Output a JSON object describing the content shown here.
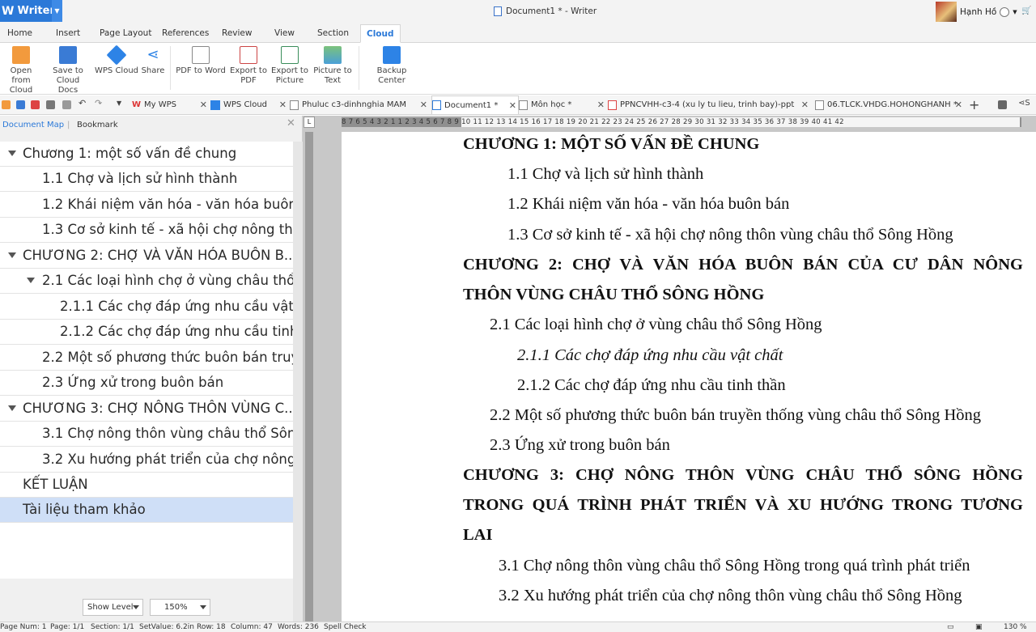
{
  "titlebar": {
    "app_name": "Writer",
    "app_logo": "W",
    "doc_title": "Document1 * - Writer",
    "user_name": "Hạnh Hồ"
  },
  "menu_tabs": [
    "Home",
    "Insert",
    "Page Layout",
    "References",
    "Review",
    "View",
    "Section",
    "Cloud"
  ],
  "active_menu_tab": "Cloud",
  "ribbon": {
    "open_cloud_docs": [
      "Open from",
      "Cloud Docs"
    ],
    "save_cloud_docs": [
      "Save to",
      "Cloud Docs"
    ],
    "wps_cloud": "WPS Cloud",
    "share": "Share",
    "pdf_to_word": "PDF to Word",
    "export_pdf": [
      "Export to",
      "PDF"
    ],
    "export_picture": [
      "Export to",
      "Picture"
    ],
    "picture_to_text": [
      "Picture to",
      "Text"
    ],
    "backup_center": "Backup Center"
  },
  "doc_tabs": [
    {
      "label": "My WPS"
    },
    {
      "label": "WPS Cloud"
    },
    {
      "label": "Phuluc c3-dinhnghia MAM"
    },
    {
      "label": "Document1 *"
    },
    {
      "label": "Môn học *"
    },
    {
      "label": "PPNCVHH-c3-4 (xu ly tu lieu, trinh bay)-ppt"
    },
    {
      "label": "06.TLCK.VHDG.HOHONGHANH *"
    }
  ],
  "left_pane": {
    "tab_document_map": "Document Map",
    "tab_bookmark": "Bookmark",
    "items": [
      {
        "text": "Chương 1: một số vấn đề chung"
      },
      {
        "text": "1.1  Chợ và lịch sử hình thành"
      },
      {
        "text": "1.2  Khái niệm văn hóa  - văn hóa buôn b"
      },
      {
        "text": "1.3 Cơ sở kinh tế - xã hội chợ nông thô..."
      },
      {
        "text": "CHƯƠNG 2: CHỢ VÀ VĂN HÓA BUÔN B..."
      },
      {
        "text": "2.1 Các loại hình chợ ở vùng châu thổ Sô"
      },
      {
        "text": "2.1.1 Các chợ đáp ứng nhu cầu vật ..."
      },
      {
        "text": "2.1.2 Các chợ đáp ứng nhu cầu tinh th"
      },
      {
        "text": "2.2 Một số phương thức buôn bán truyề"
      },
      {
        "text": "2.3 Ứng xử trong buôn bán"
      },
      {
        "text": "CHƯƠNG 3: CHỢ NÔNG THÔN VÙNG C..."
      },
      {
        "text": "3.1 Chợ nông thôn vùng châu thổ Sông.b"
      },
      {
        "text": "3.2 Xu hướng phát triển của chợ nông ..."
      },
      {
        "text": "KẾT LUẬN"
      },
      {
        "text": "Tài liệu tham khảo"
      }
    ],
    "show_level": "Show Level",
    "zoom": "150%"
  },
  "ruler_numbers": "8  7  6  5  4  3  2  1     1  2  3  4  5  6  7  8  9  10  11  12  13  14  15  16  17  18  19  20  21  22  23  24  25  26  27  28  29  30  31  32  33  34  35  36  37  38  39  40  41  42",
  "document": {
    "lines": [
      "CHƯƠNG 1: MỘT SỐ VẤN ĐỀ CHUNG",
      "1.1  Chợ và lịch sử hình thành",
      "1.2  Khái niệm văn hóa  - văn hóa buôn bán",
      "1.3 Cơ sở kinh tế - xã hội chợ nông thôn vùng châu thổ Sông Hồng",
      "CHƯƠNG 2: CHỢ VÀ VĂN HÓA BUÔN BÁN CỦA CƯ DÂN NÔNG",
      "THÔN VÙNG CHÂU THỔ SÔNG HỒNG",
      "2.1 Các loại hình chợ ở vùng châu thổ Sông Hồng",
      "2.1.1 Các chợ đáp ứng nhu cầu vật chất",
      "2.1.2 Các chợ đáp ứng nhu cầu tinh thần",
      "2.2 Một số phương thức buôn bán truyền thống vùng châu thổ Sông Hồng",
      "2.3 Ứng xử trong buôn bán",
      "CHƯƠNG 3: CHỢ NÔNG THÔN VÙNG CHÂU THỔ SÔNG HỒNG",
      "TRONG QUÁ TRÌNH PHÁT TRIỂN VÀ XU HƯỚNG TRONG TƯƠNG",
      "LAI",
      "3.1 Chợ nông thôn vùng châu thổ Sông Hồng trong quá trình phát triển",
      "3.2 Xu hướng phát triển của chợ nông thôn vùng châu thổ Sông Hồng"
    ]
  },
  "statusbar": {
    "page_num": "Page Num: 1",
    "page": "Page: 1/1",
    "section": "Section: 1/1",
    "setvalue": "SetValue: 6.2in",
    "row": "Row: 18",
    "column": "Column: 47",
    "words": "Words: 236",
    "spell_check": "Spell Check",
    "zoom": "130 %"
  },
  "colors": {
    "accent": "#2b79d8",
    "selected_item": "#cfdff7",
    "canvas": "#c8c8c8"
  }
}
